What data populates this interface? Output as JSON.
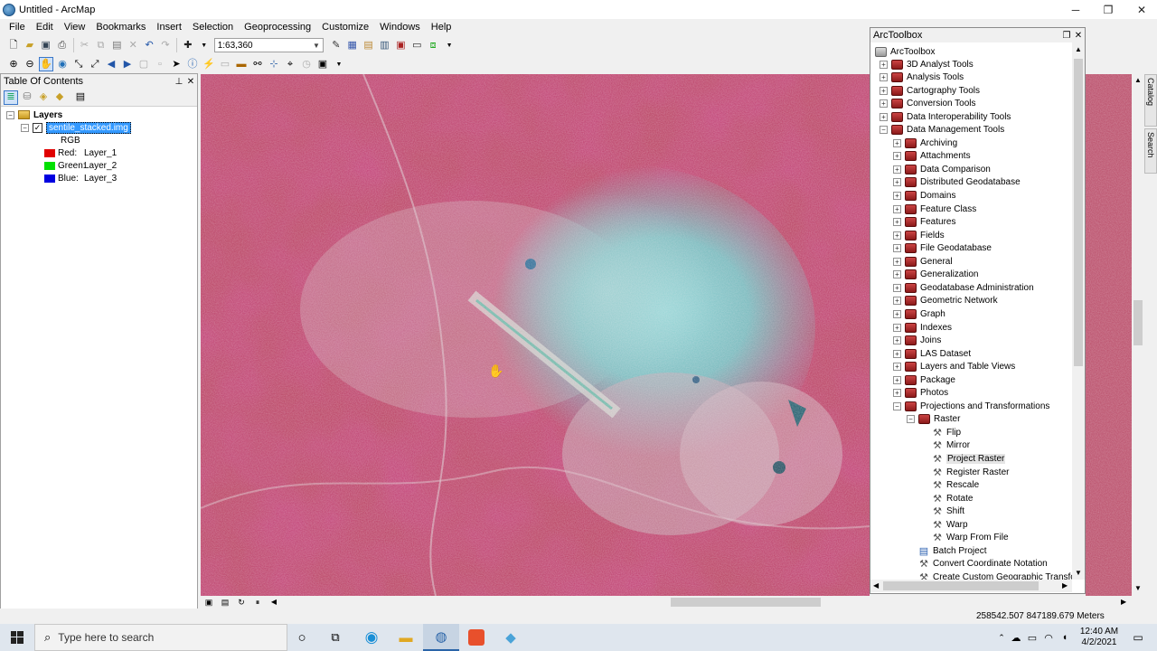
{
  "window": {
    "title": "Untitled - ArcMap",
    "minimize": "─",
    "maximize": "❐",
    "close": "✕"
  },
  "menu": [
    "File",
    "Edit",
    "View",
    "Bookmarks",
    "Insert",
    "Selection",
    "Geoprocessing",
    "Customize",
    "Windows",
    "Help"
  ],
  "toolbar": {
    "scale": "1:63,360"
  },
  "toc": {
    "title": "Table Of Contents",
    "root": "Layers",
    "layer": "sentile_stacked.img",
    "band_group": "RGB",
    "bands": [
      {
        "channel": "Red:",
        "layer": "Layer_1",
        "color": "#e00000"
      },
      {
        "channel": "Green:",
        "layer": "Layer_2",
        "color": "#00e000"
      },
      {
        "channel": "Blue:",
        "layer": "Layer_3",
        "color": "#0000e0"
      }
    ]
  },
  "arctoolbox": {
    "title": "ArcToolbox",
    "root": "ArcToolbox",
    "items": [
      {
        "label": "3D Analyst Tools",
        "kind": "toolbox",
        "level": 1,
        "exp": "+"
      },
      {
        "label": "Analysis Tools",
        "kind": "toolbox",
        "level": 1,
        "exp": "+"
      },
      {
        "label": "Cartography Tools",
        "kind": "toolbox",
        "level": 1,
        "exp": "+"
      },
      {
        "label": "Conversion Tools",
        "kind": "toolbox",
        "level": 1,
        "exp": "+"
      },
      {
        "label": "Data Interoperability Tools",
        "kind": "toolbox",
        "level": 1,
        "exp": "+"
      },
      {
        "label": "Data Management Tools",
        "kind": "toolbox",
        "level": 1,
        "exp": "−"
      },
      {
        "label": "Archiving",
        "kind": "toolset",
        "level": 2,
        "exp": "+"
      },
      {
        "label": "Attachments",
        "kind": "toolset",
        "level": 2,
        "exp": "+"
      },
      {
        "label": "Data Comparison",
        "kind": "toolset",
        "level": 2,
        "exp": "+"
      },
      {
        "label": "Distributed Geodatabase",
        "kind": "toolset",
        "level": 2,
        "exp": "+"
      },
      {
        "label": "Domains",
        "kind": "toolset",
        "level": 2,
        "exp": "+"
      },
      {
        "label": "Feature Class",
        "kind": "toolset",
        "level": 2,
        "exp": "+"
      },
      {
        "label": "Features",
        "kind": "toolset",
        "level": 2,
        "exp": "+"
      },
      {
        "label": "Fields",
        "kind": "toolset",
        "level": 2,
        "exp": "+"
      },
      {
        "label": "File Geodatabase",
        "kind": "toolset",
        "level": 2,
        "exp": "+"
      },
      {
        "label": "General",
        "kind": "toolset",
        "level": 2,
        "exp": "+"
      },
      {
        "label": "Generalization",
        "kind": "toolset",
        "level": 2,
        "exp": "+"
      },
      {
        "label": "Geodatabase Administration",
        "kind": "toolset",
        "level": 2,
        "exp": "+"
      },
      {
        "label": "Geometric Network",
        "kind": "toolset",
        "level": 2,
        "exp": "+"
      },
      {
        "label": "Graph",
        "kind": "toolset",
        "level": 2,
        "exp": "+"
      },
      {
        "label": "Indexes",
        "kind": "toolset",
        "level": 2,
        "exp": "+"
      },
      {
        "label": "Joins",
        "kind": "toolset",
        "level": 2,
        "exp": "+"
      },
      {
        "label": "LAS Dataset",
        "kind": "toolset",
        "level": 2,
        "exp": "+"
      },
      {
        "label": "Layers and Table Views",
        "kind": "toolset",
        "level": 2,
        "exp": "+"
      },
      {
        "label": "Package",
        "kind": "toolset",
        "level": 2,
        "exp": "+"
      },
      {
        "label": "Photos",
        "kind": "toolset",
        "level": 2,
        "exp": "+"
      },
      {
        "label": "Projections and Transformations",
        "kind": "toolset",
        "level": 2,
        "exp": "−"
      },
      {
        "label": "Raster",
        "kind": "toolset",
        "level": 3,
        "exp": "−"
      },
      {
        "label": "Flip",
        "kind": "tool",
        "level": 4,
        "exp": ""
      },
      {
        "label": "Mirror",
        "kind": "tool",
        "level": 4,
        "exp": ""
      },
      {
        "label": "Project Raster",
        "kind": "tool",
        "level": 4,
        "exp": "",
        "selected": true
      },
      {
        "label": "Register Raster",
        "kind": "tool",
        "level": 4,
        "exp": ""
      },
      {
        "label": "Rescale",
        "kind": "tool",
        "level": 4,
        "exp": ""
      },
      {
        "label": "Rotate",
        "kind": "tool",
        "level": 4,
        "exp": ""
      },
      {
        "label": "Shift",
        "kind": "tool",
        "level": 4,
        "exp": ""
      },
      {
        "label": "Warp",
        "kind": "tool",
        "level": 4,
        "exp": ""
      },
      {
        "label": "Warp From File",
        "kind": "tool",
        "level": 4,
        "exp": ""
      },
      {
        "label": "Batch Project",
        "kind": "script",
        "level": 3,
        "exp": ""
      },
      {
        "label": "Convert Coordinate Notation",
        "kind": "tool",
        "level": 3,
        "exp": ""
      },
      {
        "label": "Create Custom Geographic Transformation",
        "kind": "tool",
        "level": 3,
        "exp": ""
      }
    ]
  },
  "side_tabs": [
    "Catalog",
    "Search"
  ],
  "status": {
    "coords": "258542.507  847189.679 Meters"
  },
  "taskbar": {
    "search_placeholder": "Type here to search",
    "time": "12:40 AM",
    "date": "4/2/2021"
  }
}
